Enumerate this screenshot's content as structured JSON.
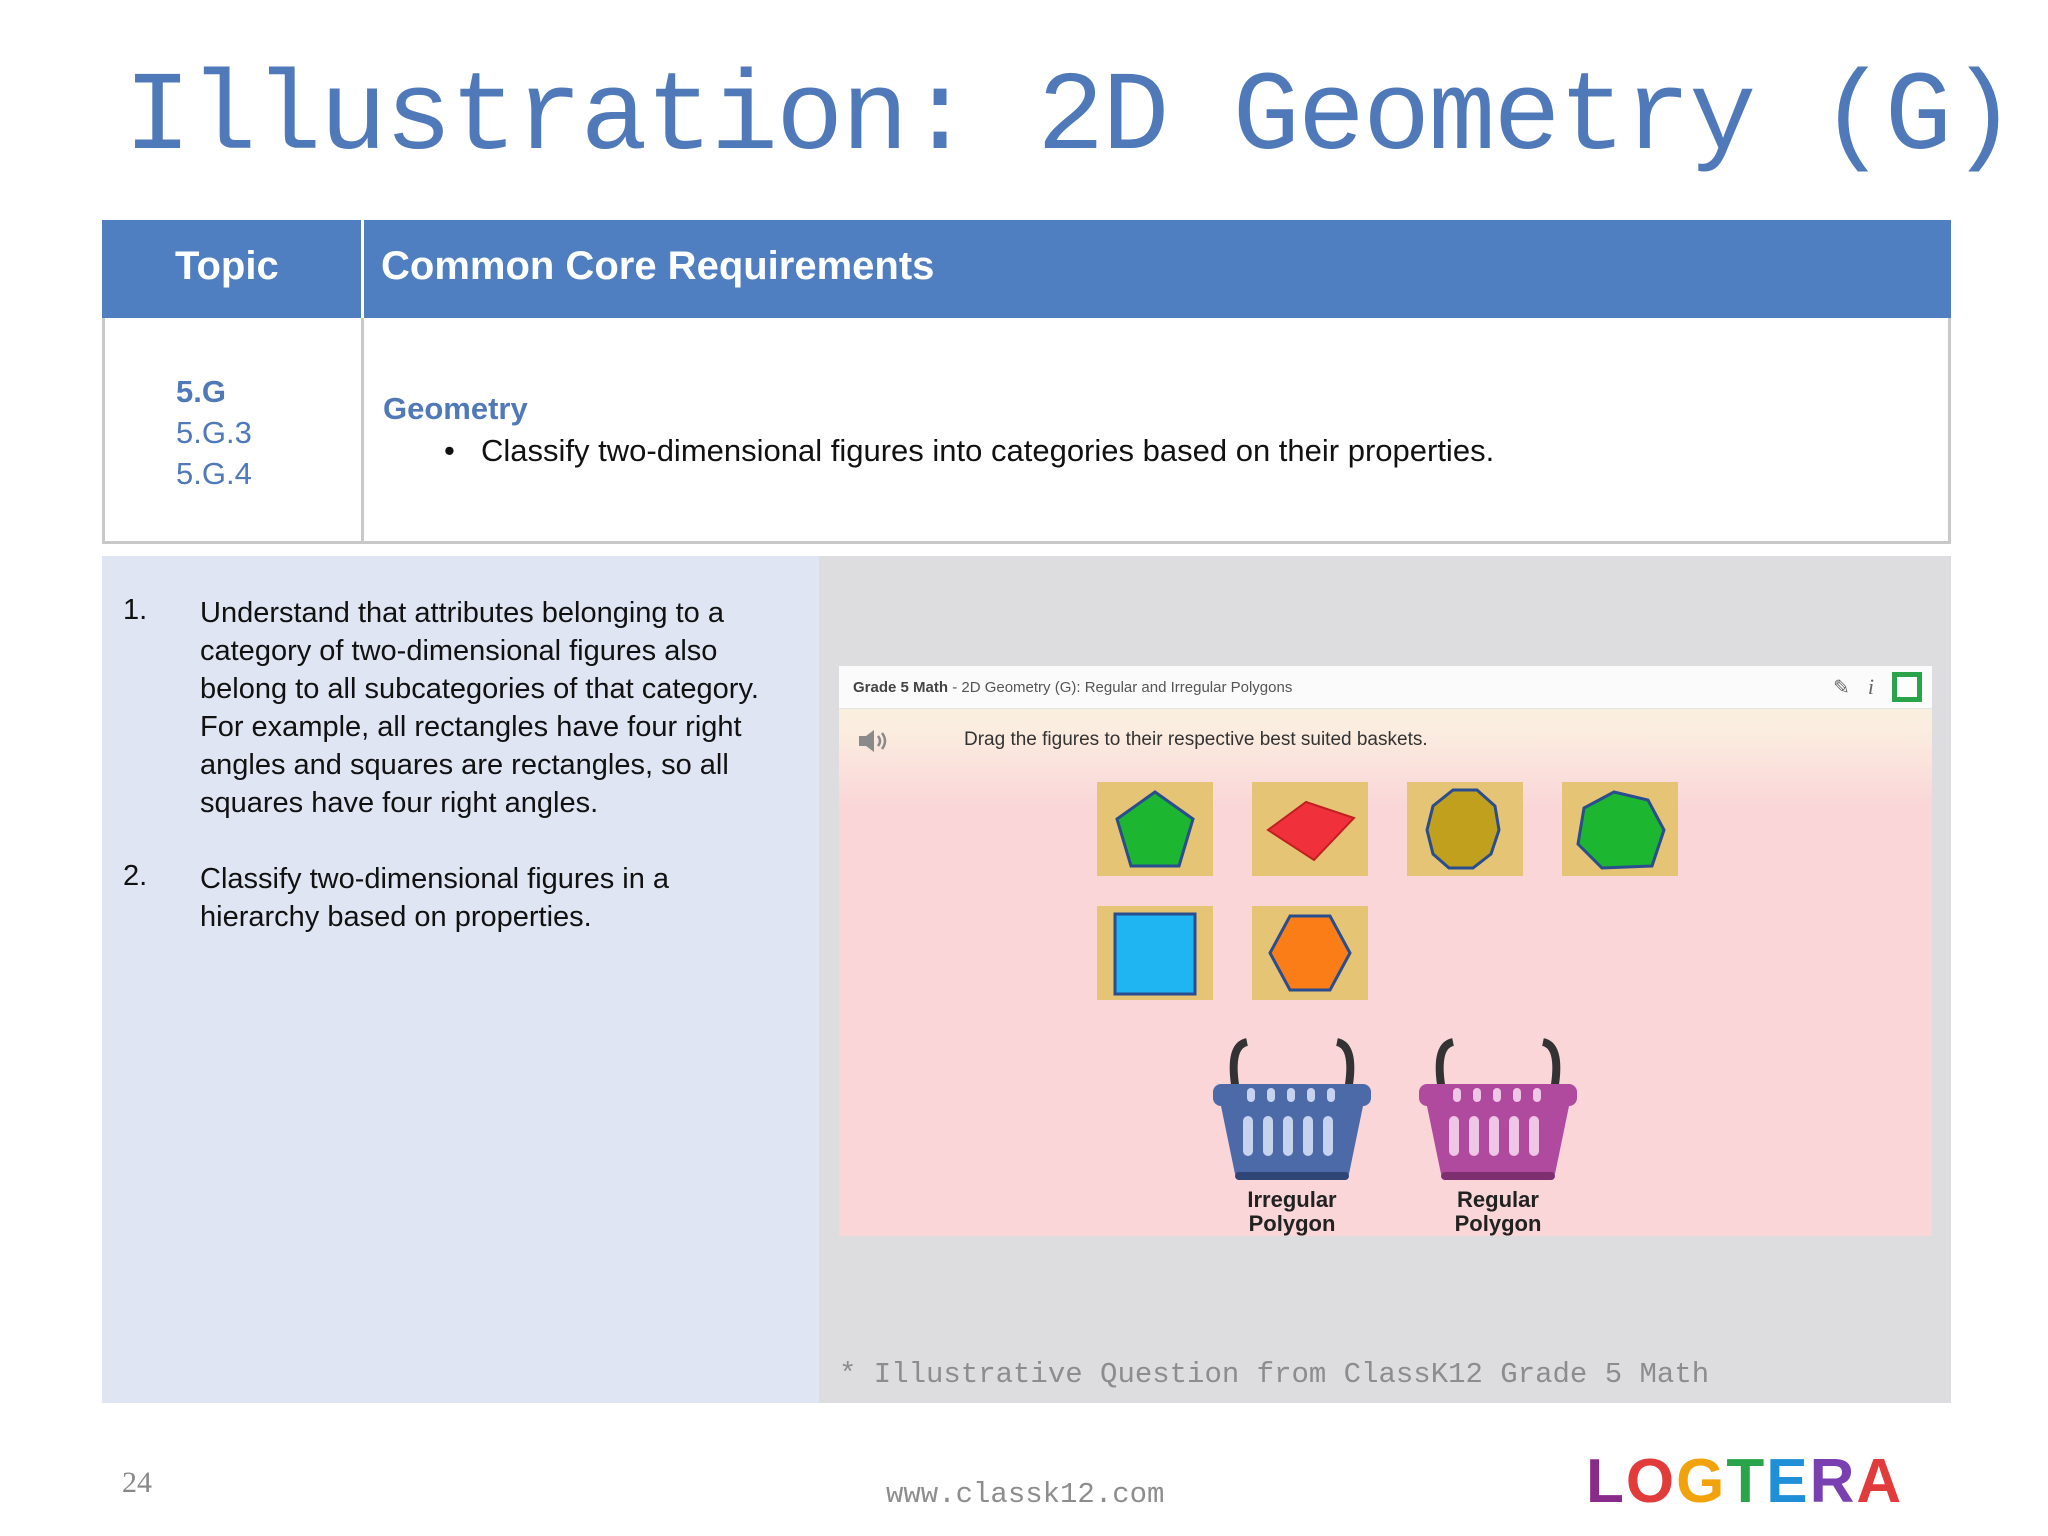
{
  "slide": {
    "title": "Illustration: 2D Geometry (G)",
    "page_number": "24",
    "footer_url": "www.classk12.com",
    "logo_text": "LOGTERA"
  },
  "table": {
    "header_topic": "Topic",
    "header_requirements": "Common Core Requirements",
    "topic_main": "5.G",
    "topic_subs": [
      "5.G.3",
      "5.G.4"
    ],
    "requirement_heading": "Geometry",
    "requirement_bullet": "Classify two-dimensional figures into categories based on their properties."
  },
  "standards": [
    {
      "num": "1.",
      "text": "Understand that attributes belonging to a category of two-dimensional figures also belong to all subcategories of that category. For example, all rectangles have four right angles and squares are rectangles, so all squares have four right angles."
    },
    {
      "num": "2.",
      "text": "Classify two-dimensional figures in a hierarchy based on properties."
    }
  ],
  "activity": {
    "breadcrumb_bold": "Grade 5 Math",
    "breadcrumb_rest": " - 2D Geometry (G): Regular and Irregular Polygons",
    "instruction": "Drag the figures to their respective best suited baskets.",
    "shapes": [
      {
        "icon": "green-pentagon-icon",
        "color": "#1cb631"
      },
      {
        "icon": "red-rhombus-icon",
        "color": "#f0313b"
      },
      {
        "icon": "olive-octagon-icon",
        "color": "#c0a01c"
      },
      {
        "icon": "green-heptagon-icon",
        "color": "#1cb631"
      },
      {
        "icon": "blue-square-icon",
        "color": "#1fb4f2"
      },
      {
        "icon": "orange-hexagon-icon",
        "color": "#fb7d18"
      }
    ],
    "baskets": [
      {
        "label_line1": "Irregular",
        "label_line2": "Polygon",
        "color": "#4d6aa8"
      },
      {
        "label_line1": "Regular",
        "label_line2": "Polygon",
        "color": "#b04a9e"
      }
    ],
    "caption": "* Illustrative Question from ClassK12 Grade 5 Math"
  }
}
